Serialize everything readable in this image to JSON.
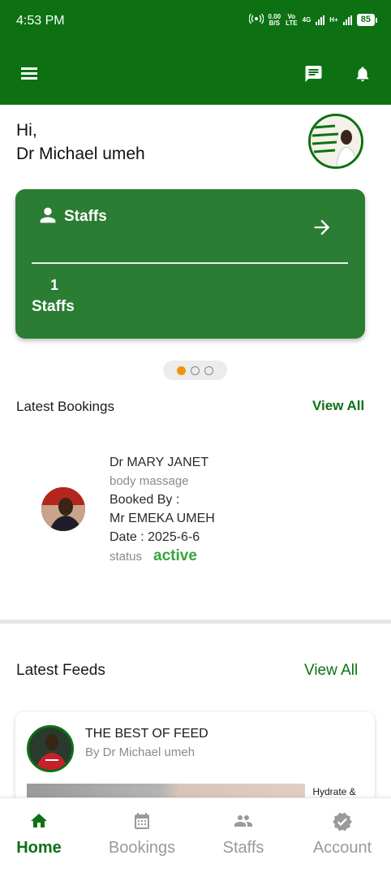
{
  "status_bar": {
    "time": "4:53 PM",
    "net_speed_top": "0.00",
    "net_speed_bottom": "B/S",
    "volte_top": "Vo",
    "volte_bottom": "LTE",
    "network_1": "4G",
    "network_2": "H+",
    "battery": "85"
  },
  "header": {
    "greeting": "Hi,",
    "user_name": "Dr Michael umeh"
  },
  "staff_card": {
    "title": "Staffs",
    "count": "1",
    "label": "Staffs"
  },
  "carousel": {
    "total": 3,
    "active_index": 0
  },
  "bookings": {
    "section_title": "Latest Bookings",
    "view_all": "View All",
    "item": {
      "name": "Dr MARY JANET",
      "service": "body massage",
      "booked_by_label": "Booked By :",
      "booked_by": "Mr EMEKA UMEH",
      "date": "Date : 2025-6-6",
      "status_label": "status",
      "status": "active"
    }
  },
  "feeds": {
    "section_title": "Latest Feeds",
    "view_all": "View All",
    "item": {
      "title": "THE BEST OF FEED",
      "author": "By Dr Michael umeh",
      "image_caption": "Hydrate &"
    }
  },
  "bottom_nav": {
    "items": [
      {
        "label": "Home",
        "icon": "home-icon",
        "active": true
      },
      {
        "label": "Bookings",
        "icon": "calendar-icon",
        "active": false
      },
      {
        "label": "Staffs",
        "icon": "people-icon",
        "active": false
      },
      {
        "label": "Account",
        "icon": "verified-badge-icon",
        "active": false
      }
    ]
  },
  "colors": {
    "primary": "#0d7114",
    "card": "#2a7d32",
    "status_active": "#34a53d",
    "pager_active": "#f0940a"
  }
}
